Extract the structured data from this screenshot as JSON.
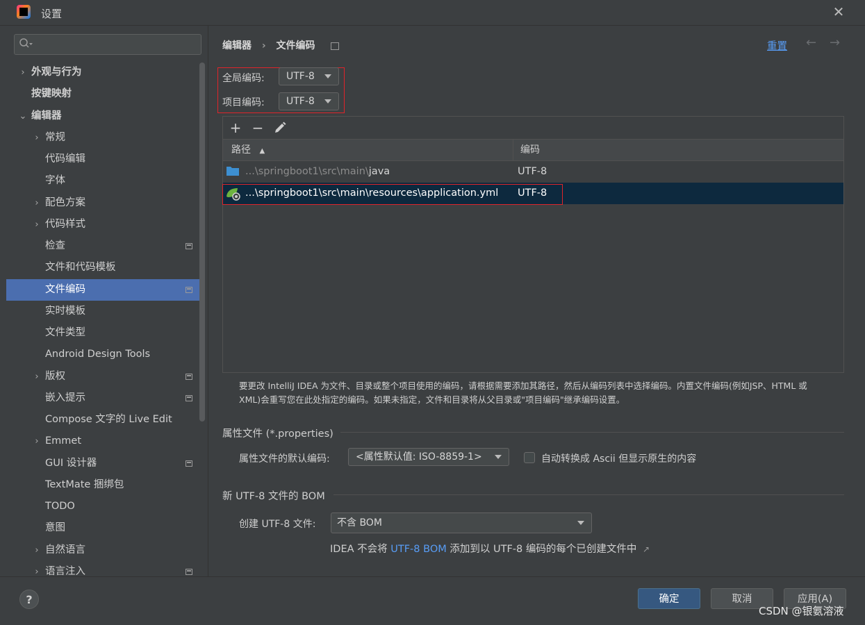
{
  "window": {
    "title": "设置"
  },
  "search": {
    "placeholder": ""
  },
  "sidebar": {
    "items": [
      {
        "label": "外观与行为"
      },
      {
        "label": "按键映射"
      },
      {
        "label": "编辑器"
      },
      {
        "label": "常规"
      },
      {
        "label": "代码编辑"
      },
      {
        "label": "字体"
      },
      {
        "label": "配色方案"
      },
      {
        "label": "代码样式"
      },
      {
        "label": "检查"
      },
      {
        "label": "文件和代码模板"
      },
      {
        "label": "文件编码"
      },
      {
        "label": "实时模板"
      },
      {
        "label": "文件类型"
      },
      {
        "label": "Android Design Tools"
      },
      {
        "label": "版权"
      },
      {
        "label": "嵌入提示"
      },
      {
        "label": "Compose 文字的 Live Edit"
      },
      {
        "label": "Emmet"
      },
      {
        "label": "GUI 设计器"
      },
      {
        "label": "TextMate 捆绑包"
      },
      {
        "label": "TODO"
      },
      {
        "label": "意图"
      },
      {
        "label": "自然语言"
      },
      {
        "label": "语言注入"
      }
    ]
  },
  "main": {
    "breadcrumb": [
      "编辑器",
      "文件编码"
    ],
    "arrow_separator": "›",
    "reset_label": "重置",
    "global_encoding": {
      "label": "全局编码:",
      "value": "UTF-8"
    },
    "project_encoding": {
      "label": "项目编码:",
      "value": "UTF-8"
    },
    "table": {
      "columns": [
        "路径",
        "编码"
      ],
      "rows": [
        {
          "path_prefix": "...\\springboot1\\src\\main\\",
          "path_name": "java",
          "encoding": "UTF-8",
          "icon": "folder-icon"
        },
        {
          "path_prefix": "...\\springboot1\\src\\main\\",
          "path_name": "resources\\application.yml",
          "encoding": "UTF-8",
          "icon": "spring-config-icon",
          "selected": true
        }
      ]
    },
    "help_text_line1": "要更改 IntelliJ IDEA 为文件、目录或整个项目使用的编码，请根据需要添加其路径，然后从编码列表中选择编码。内置文件编码(例如JSP、HTML 或",
    "help_text_line2": "XML)会重写您在此处指定的编码。如果未指定，文件和目录将从父目录或\"项目编码\"继承编码设置。",
    "properties": {
      "section_title": "属性文件 (*.properties)",
      "default_encoding_label": "属性文件的默认编码:",
      "default_encoding_value": "<属性默认值: ISO-8859-1>",
      "ascii_checkbox_label": "自动转换成 Ascii 但显示原生的内容",
      "ascii_checked": false
    },
    "bom": {
      "section_title": "新 UTF-8 文件的 BOM",
      "create_label": "创建 UTF-8 文件:",
      "create_value": "不含 BOM",
      "note_prefix": "IDEA 不会将 ",
      "note_link": "UTF-8 BOM",
      "note_suffix": " 添加到以 UTF-8 编码的每个已创建文件中",
      "note_arrow": "↗"
    }
  },
  "buttons": {
    "help": "?",
    "ok": "确定",
    "cancel": "取消",
    "apply": "应用(A)"
  },
  "watermark": "CSDN @银氨溶液",
  "colors": {
    "accent": "#4b6eaf",
    "link": "#589df6",
    "highlight_box": "#e0242a",
    "selected_row": "#0d293e"
  }
}
